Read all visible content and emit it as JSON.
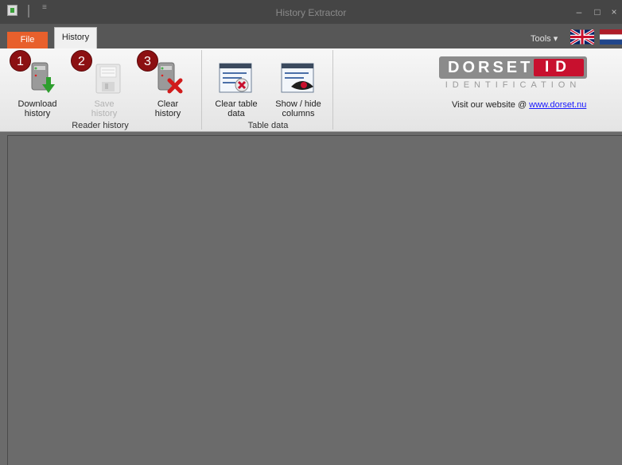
{
  "window": {
    "title": "History Extractor",
    "qat_glyph": "≡",
    "minimize_glyph": "–",
    "maximize_glyph": "□",
    "close_glyph": "×"
  },
  "tabs": {
    "file": "File",
    "history": "History"
  },
  "tools": {
    "label": "Tools ▾"
  },
  "reader_history": {
    "group_label": "Reader history",
    "buttons": [
      {
        "label_line1": "Download",
        "label_line2": "history",
        "badge": "1",
        "enabled": true,
        "icon": "download-history-icon"
      },
      {
        "label_line1": "Save",
        "label_line2": "history",
        "badge": "2",
        "enabled": false,
        "icon": "save-history-icon"
      },
      {
        "label_line1": "Clear",
        "label_line2": "history",
        "badge": "3",
        "enabled": true,
        "icon": "clear-history-icon"
      }
    ]
  },
  "table_data": {
    "group_label": "Table data",
    "buttons": [
      {
        "label_line1": "Clear table",
        "label_line2": "data",
        "icon": "clear-table-icon"
      },
      {
        "label_line1": "Show / hide",
        "label_line2": "columns",
        "icon": "show-hide-columns-icon"
      }
    ]
  },
  "brand": {
    "name": "DORSET",
    "id": "ID",
    "tagline": "IDENTIFICATION",
    "website_prefix": "Visit our website @ ",
    "website_link": "www.dorset.nu"
  },
  "colors": {
    "file_tab": "#e8602c",
    "badge": "#8c1012",
    "brand_red": "#c8102e",
    "content_bg": "#6b6b6b"
  }
}
